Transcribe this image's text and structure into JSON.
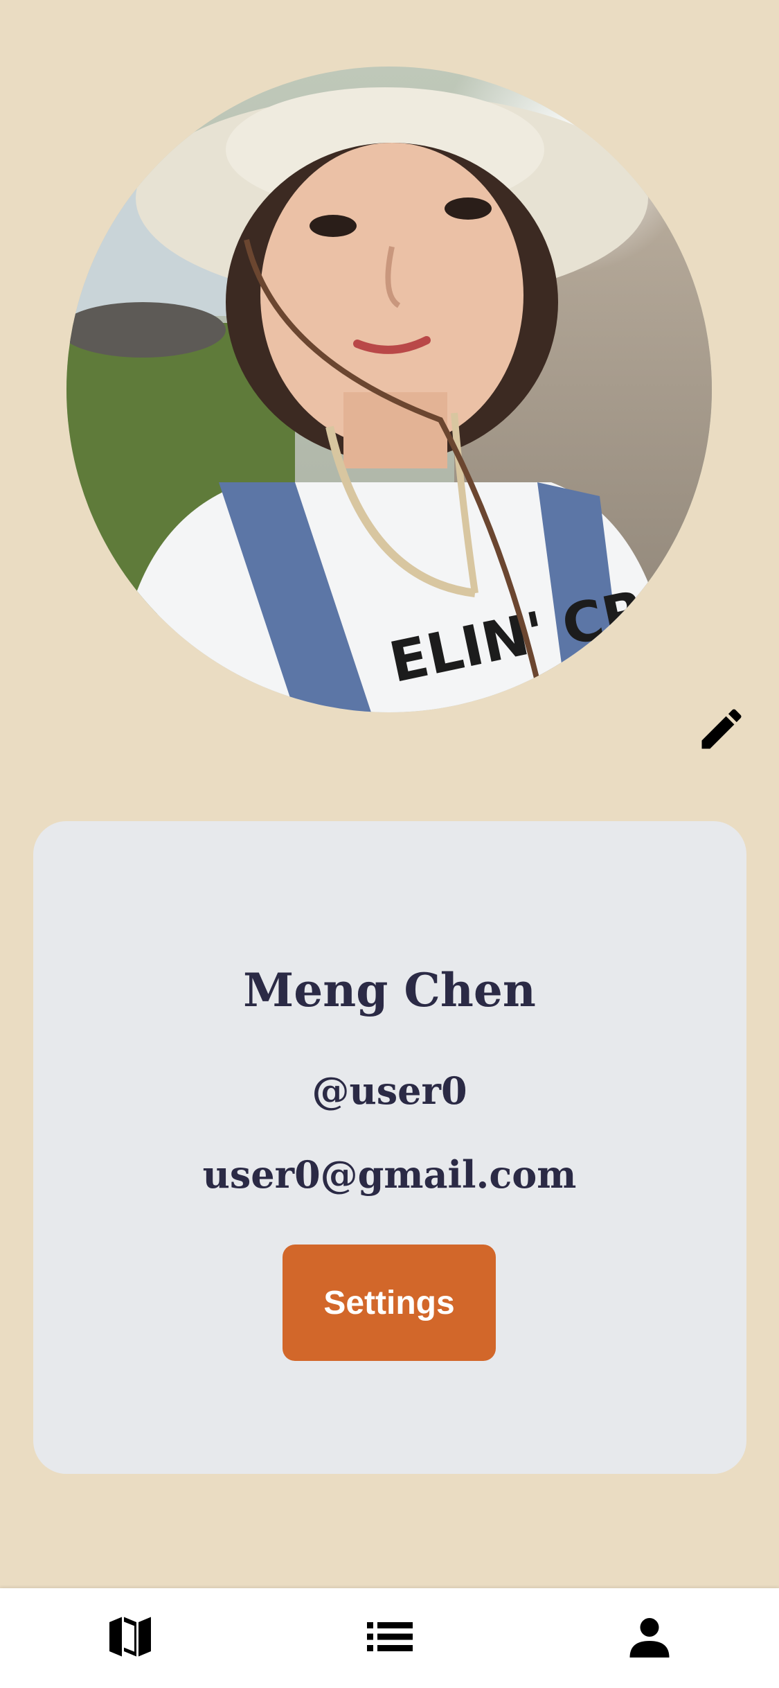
{
  "profile": {
    "name": "Meng Chen",
    "handle": "@user0",
    "email": "user0@gmail.com",
    "avatar_icon": "profile-photo"
  },
  "actions": {
    "edit_icon": "pencil-icon",
    "settings_label": "Settings"
  },
  "tabbar": {
    "tabs": [
      {
        "icon": "map-icon"
      },
      {
        "icon": "list-icon"
      },
      {
        "icon": "person-icon"
      }
    ]
  },
  "colors": {
    "background": "#EADCC2",
    "card": "#E7E9EC",
    "text": "#2B2A45",
    "accent": "#D2672A",
    "tabbar": "#FFFFFF"
  }
}
